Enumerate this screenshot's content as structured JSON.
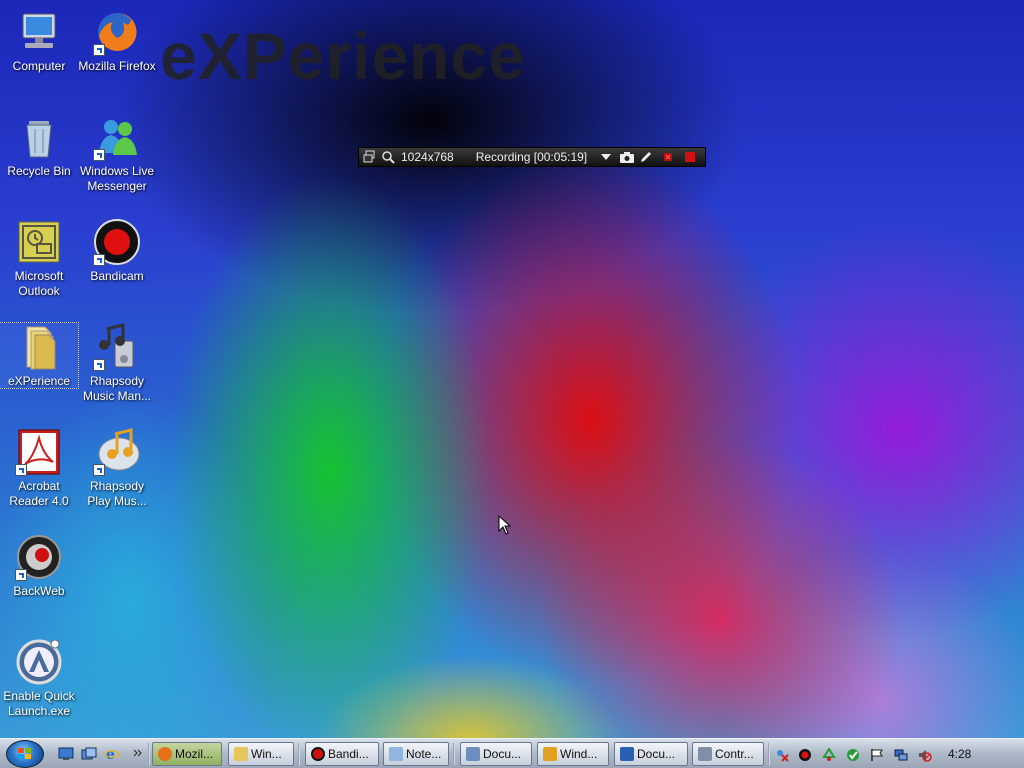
{
  "desktop": {
    "brand_text": "eXPerience",
    "icons": [
      {
        "label": "Computer"
      },
      {
        "label": "Mozilla Firefox"
      },
      {
        "label": "Recycle Bin"
      },
      {
        "label": "Windows Live Messenger"
      },
      {
        "label": "Microsoft Outlook"
      },
      {
        "label": "Bandicam"
      },
      {
        "label": "eXPerience"
      },
      {
        "label": "Rhapsody Music Man..."
      },
      {
        "label": "Acrobat Reader 4.0"
      },
      {
        "label": "Rhapsody Play Mus..."
      },
      {
        "label": "BackWeb"
      },
      {
        "label": "Enable Quick Launch.exe"
      }
    ]
  },
  "recording_toolbar": {
    "resolution": "1024x768",
    "status": "Recording [00:05:19]"
  },
  "taskbar": {
    "buttons": [
      {
        "label": "Mozil...",
        "color": "#e8701a"
      },
      {
        "label": "Win...",
        "color": "#e6c55a"
      },
      {
        "label": "Bandi...",
        "color": "#d01010"
      },
      {
        "label": "Note...",
        "color": "#8fb5e0"
      },
      {
        "label": "Docu...",
        "color": "#6d8fbf"
      },
      {
        "label": "Wind...",
        "color": "#e0a020"
      },
      {
        "label": "Docu...",
        "color": "#2b5fb3"
      },
      {
        "label": "Contr...",
        "color": "#7f8fa7"
      }
    ],
    "clock": "4:28"
  },
  "colors": {
    "accent": "#2a74c8",
    "record_red": "#d01010"
  }
}
